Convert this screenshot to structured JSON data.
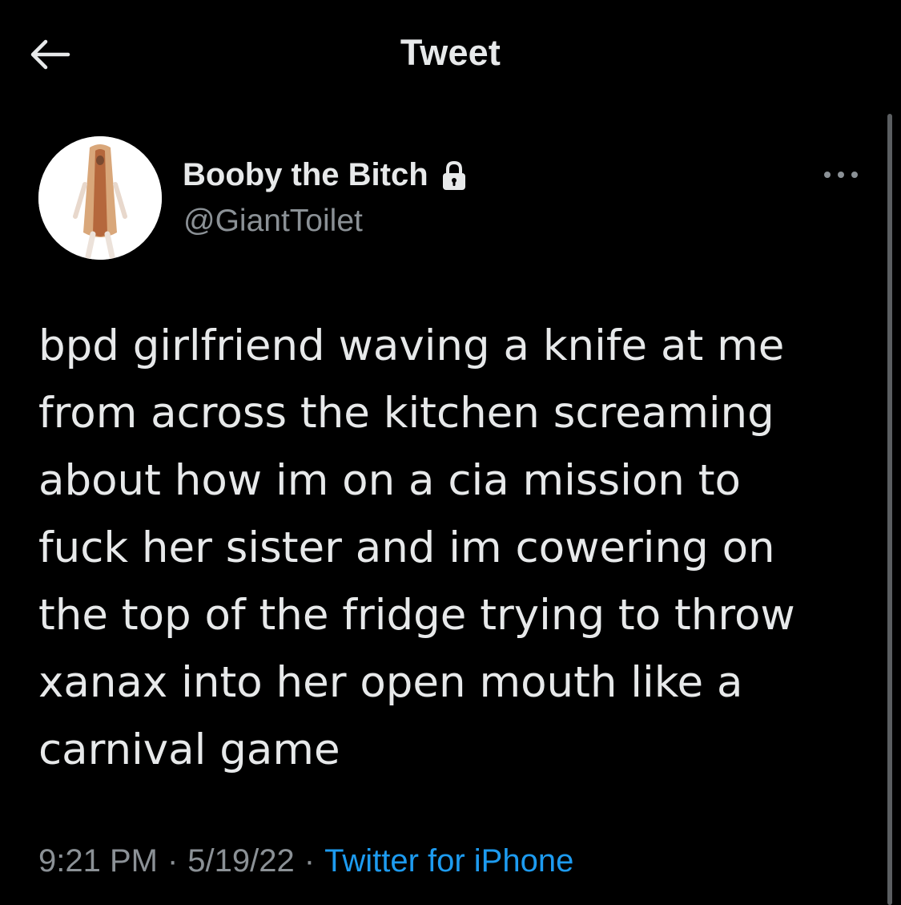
{
  "header": {
    "title": "Tweet",
    "back_icon": "arrow-left-icon"
  },
  "tweet": {
    "author": {
      "display_name": "Booby the Bitch",
      "handle": "@GiantToilet",
      "protected_icon": "lock-icon",
      "avatar": "hotdog-costume-avatar"
    },
    "more_icon": "more-horizontal-icon",
    "text": "bpd girlfriend waving a knife at me\nfrom across the kitchen screaming\nabout how im on a cia mission to\nfuck her sister and im cowering on\nthe top of the fridge trying to throw\nxanax into her open mouth like a\ncarnival game",
    "time": "9:21 PM",
    "separator": "·",
    "date": "5/19/22",
    "source": "Twitter for iPhone"
  },
  "colors": {
    "background": "#000000",
    "text_primary": "#e7e9ea",
    "text_secondary": "#8b9196",
    "link": "#1d9bf0"
  }
}
